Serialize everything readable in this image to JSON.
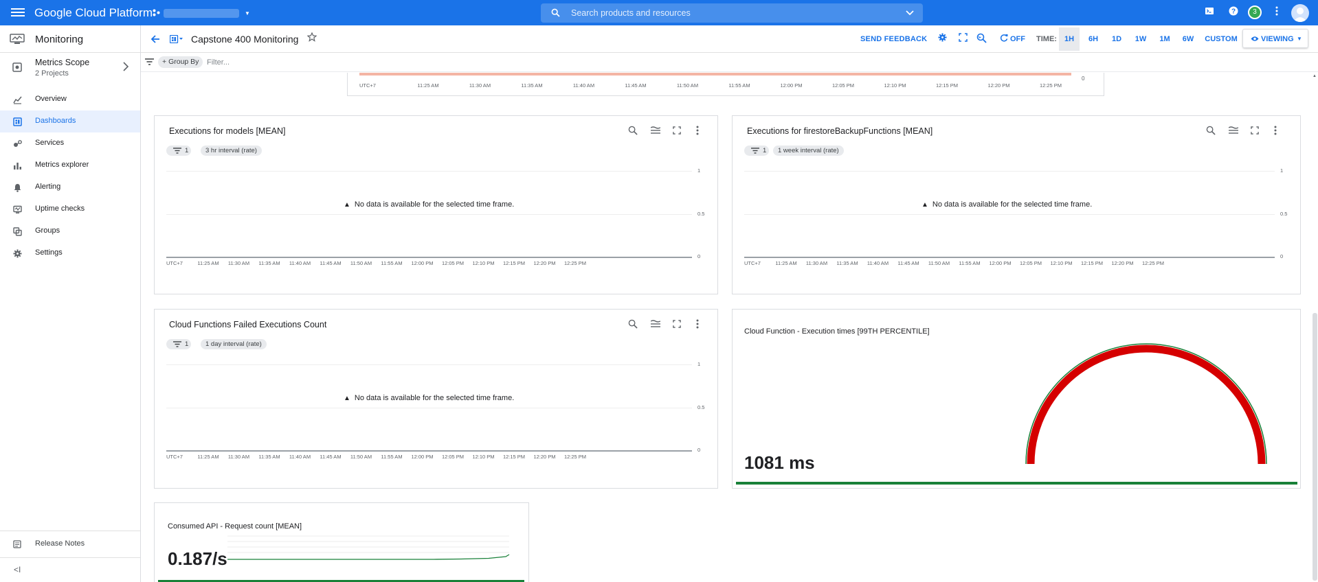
{
  "topbar": {
    "brand": "Google Cloud Platform",
    "search_placeholder": "Search products and resources",
    "notification_count": "3"
  },
  "sidebar": {
    "product": "Monitoring",
    "scope": {
      "title": "Metrics Scope",
      "subtitle": "2 Projects"
    },
    "items": [
      {
        "label": "Overview",
        "icon": "overview-icon",
        "active": false
      },
      {
        "label": "Dashboards",
        "icon": "dashboards-icon",
        "active": true
      },
      {
        "label": "Services",
        "icon": "services-icon",
        "active": false
      },
      {
        "label": "Metrics explorer",
        "icon": "metrics-explorer-icon",
        "active": false
      },
      {
        "label": "Alerting",
        "icon": "bell-icon",
        "active": false
      },
      {
        "label": "Uptime checks",
        "icon": "uptime-icon",
        "active": false
      },
      {
        "label": "Groups",
        "icon": "groups-icon",
        "active": false
      },
      {
        "label": "Settings",
        "icon": "gear-icon",
        "active": false
      }
    ],
    "footer": {
      "release_notes": "Release Notes",
      "collapse": "<I"
    }
  },
  "dashboard": {
    "title": "Capstone 400 Monitoring",
    "send_feedback": "SEND FEEDBACK",
    "auto_refresh": "OFF",
    "time_label": "TIME:",
    "time_ranges": [
      "1H",
      "6H",
      "1D",
      "1W",
      "1M",
      "6W",
      "CUSTOM"
    ],
    "selected_range": "1H",
    "viewing": "VIEWING"
  },
  "filter_bar": {
    "group_by": "Group By",
    "placeholder": "Filter..."
  },
  "time_axis": {
    "timezone": "UTC+7",
    "ticks": [
      "11:25 AM",
      "11:30 AM",
      "11:35 AM",
      "11:40 AM",
      "11:45 AM",
      "11:50 AM",
      "11:55 AM",
      "12:00 PM",
      "12:05 PM",
      "12:10 PM",
      "12:15 PM",
      "12:20 PM",
      "12:25 PM"
    ]
  },
  "top_partial_chart": {
    "y_tick": "0",
    "bar_color": "#f4b5a4"
  },
  "charts": [
    {
      "title": "Executions for models [MEAN]",
      "filter_count": "1",
      "interval": "3 hr interval (rate)",
      "no_data": "No data is available for the selected time frame.",
      "y_ticks": [
        "1",
        "0.5",
        "0"
      ]
    },
    {
      "title": "Executions for firestoreBackupFunctions [MEAN]",
      "filter_count": "1",
      "interval": "1 week interval (rate)",
      "no_data": "No data is available for the selected time frame.",
      "y_ticks": [
        "1",
        "0.5",
        "0"
      ]
    },
    {
      "title": "Cloud Functions Failed Executions Count",
      "filter_count": "1",
      "interval": "1 day interval (rate)",
      "no_data": "No data is available for the selected time frame.",
      "y_ticks": [
        "1",
        "0.5",
        "0"
      ]
    }
  ],
  "gauge": {
    "title": "Cloud Function - Execution times [99TH PERCENTILE]",
    "value": "1081 ms",
    "arc_color": "#d50000",
    "outline_color": "#188038"
  },
  "scorecard": {
    "title": "Consumed API - Request count [MEAN]",
    "value": "0.187/s",
    "spark_color": "#188038"
  }
}
